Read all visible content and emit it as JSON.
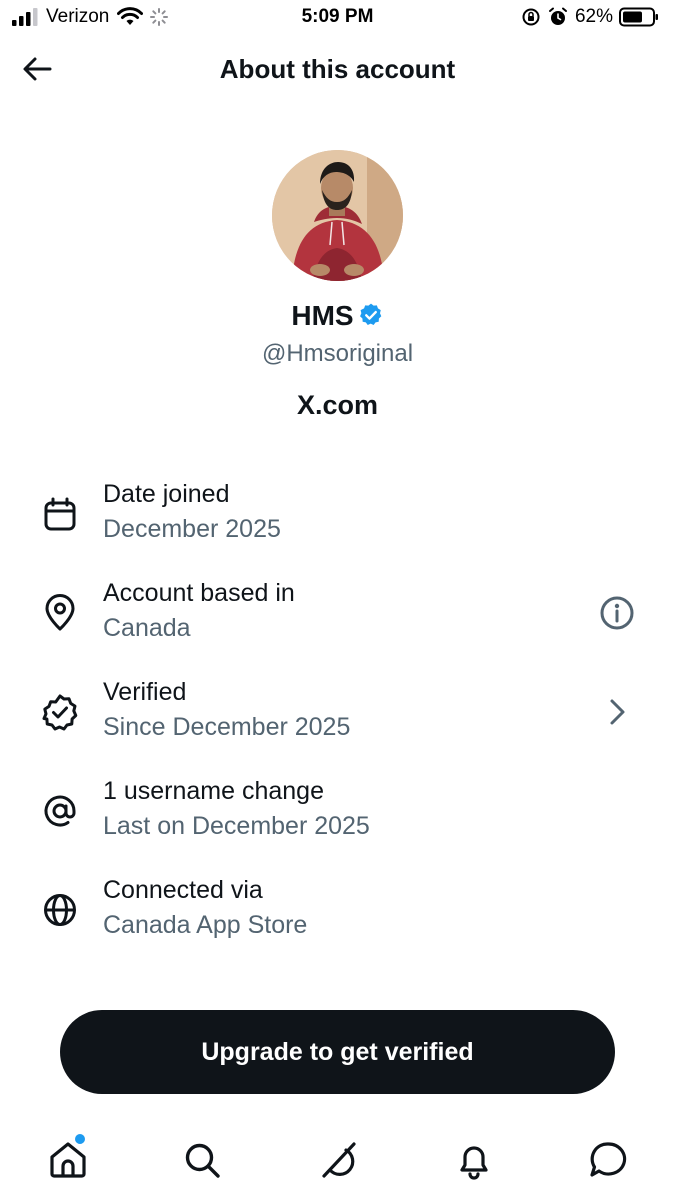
{
  "status_bar": {
    "carrier": "Verizon",
    "time": "5:09 PM",
    "battery_percent": "62%"
  },
  "header": {
    "title": "About this account",
    "back_icon": "arrow-left-icon"
  },
  "profile": {
    "display_name": "HMS",
    "handle": "@Hmsoriginal",
    "site": "X.com",
    "verified_color": "#1d9bf0"
  },
  "info": [
    {
      "icon": "calendar-icon",
      "title": "Date joined",
      "subtitle": "December 2025"
    },
    {
      "icon": "location-pin-icon",
      "title": "Account based in",
      "subtitle": "Canada",
      "trailing": "info-icon"
    },
    {
      "icon": "verified-badge-icon",
      "title": "Verified",
      "subtitle": "Since December 2025",
      "trailing": "chevron-right-icon"
    },
    {
      "icon": "at-sign-icon",
      "title": "1 username change",
      "subtitle": "Last on December 2025"
    },
    {
      "icon": "globe-icon",
      "title": "Connected via",
      "subtitle": "Canada App Store"
    }
  ],
  "cta": {
    "label": "Upgrade to get verified"
  },
  "tabbar": {
    "items": [
      "home-icon",
      "search-icon",
      "grok-icon",
      "notifications-icon",
      "messages-icon"
    ],
    "home_badge_color": "#1d9bf0"
  },
  "colors": {
    "text_primary": "#0f1419",
    "text_secondary": "#536471",
    "accent": "#1d9bf0",
    "button_bg": "#0f1419"
  }
}
